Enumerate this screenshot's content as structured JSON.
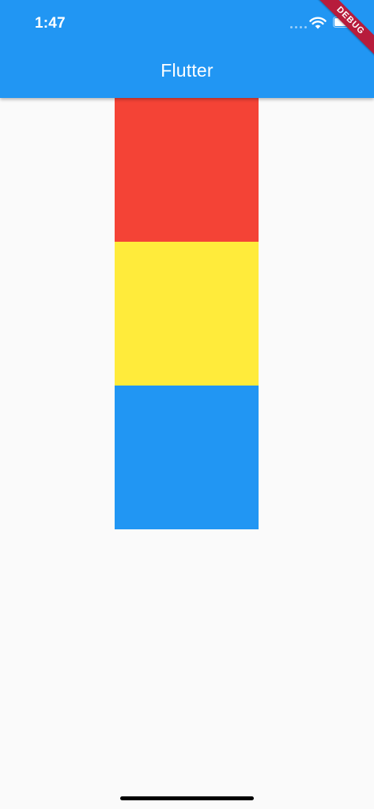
{
  "status_bar": {
    "time": "1:47"
  },
  "app_bar": {
    "title": "Flutter"
  },
  "debug_banner": {
    "label": "DEBUG"
  },
  "boxes": [
    {
      "color": "#f44336"
    },
    {
      "color": "#ffeb3b"
    },
    {
      "color": "#2196f3"
    }
  ],
  "colors": {
    "app_bar": "#2196f3",
    "background": "#fafafa",
    "debug_banner": "#b71c3c"
  },
  "icons": [
    "cellular-signal-icon",
    "wifi-icon",
    "battery-icon"
  ]
}
